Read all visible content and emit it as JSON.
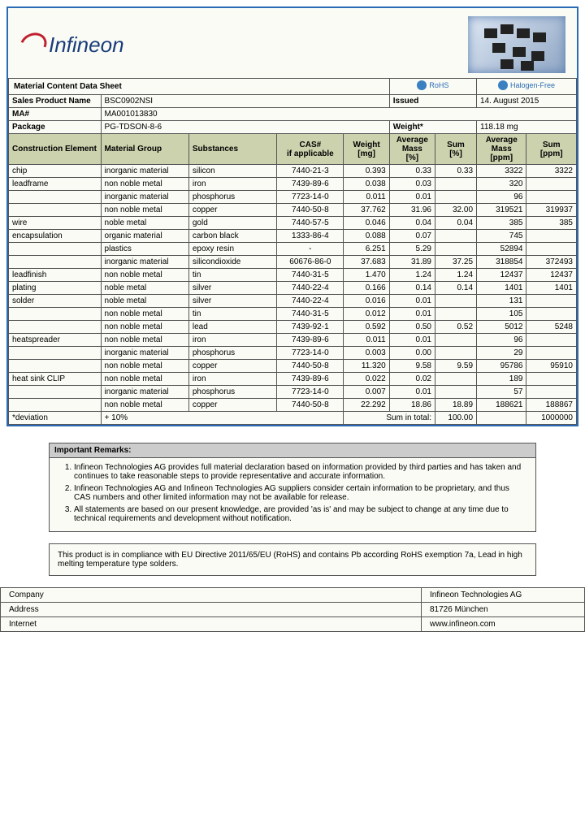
{
  "brand": "Infineon",
  "title": "Material Content Data Sheet",
  "badges": {
    "rohs": "RoHS",
    "halogenfree": "Halogen-Free"
  },
  "fields": {
    "sales_label": "Sales Product Name",
    "sales_value": "BSC0902NSI",
    "issued_label": "Issued",
    "issued_value": "14. August 2015",
    "ma_label": "MA#",
    "ma_value": "MA001013830",
    "package_label": "Package",
    "package_value": "PG-TDSON-8-6",
    "weight_label": "Weight*",
    "weight_value": "118.18 mg"
  },
  "cols": {
    "construction": "Construction Element",
    "group": "Material Group",
    "substance": "Substances",
    "cas": "CAS#\nif applicable",
    "wt_mg": "Weight\n[mg]",
    "avg_pct": "Average\nMass\n[%]",
    "sum_pct": "Sum\n[%]",
    "avg_ppm": "Average\nMass\n[ppm]",
    "sum_ppm": "Sum\n[ppm]"
  },
  "rows": [
    {
      "c": "chip",
      "g": "inorganic material",
      "s": "silicon",
      "cas": "7440-21-3",
      "w": "0.393",
      "ap": "0.33",
      "sp": "0.33",
      "appm": "3322",
      "sppm": "3322"
    },
    {
      "c": "leadframe",
      "g": "non noble metal",
      "s": "iron",
      "cas": "7439-89-6",
      "w": "0.038",
      "ap": "0.03",
      "sp": "",
      "appm": "320",
      "sppm": ""
    },
    {
      "c": "",
      "g": "inorganic material",
      "s": "phosphorus",
      "cas": "7723-14-0",
      "w": "0.011",
      "ap": "0.01",
      "sp": "",
      "appm": "96",
      "sppm": ""
    },
    {
      "c": "",
      "g": "non noble metal",
      "s": "copper",
      "cas": "7440-50-8",
      "w": "37.762",
      "ap": "31.96",
      "sp": "32.00",
      "appm": "319521",
      "sppm": "319937"
    },
    {
      "c": "wire",
      "g": "noble metal",
      "s": "gold",
      "cas": "7440-57-5",
      "w": "0.046",
      "ap": "0.04",
      "sp": "0.04",
      "appm": "385",
      "sppm": "385"
    },
    {
      "c": "encapsulation",
      "g": "organic material",
      "s": "carbon black",
      "cas": "1333-86-4",
      "w": "0.088",
      "ap": "0.07",
      "sp": "",
      "appm": "745",
      "sppm": ""
    },
    {
      "c": "",
      "g": "plastics",
      "s": "epoxy resin",
      "cas": "-",
      "w": "6.251",
      "ap": "5.29",
      "sp": "",
      "appm": "52894",
      "sppm": ""
    },
    {
      "c": "",
      "g": "inorganic material",
      "s": "silicondioxide",
      "cas": "60676-86-0",
      "w": "37.683",
      "ap": "31.89",
      "sp": "37.25",
      "appm": "318854",
      "sppm": "372493"
    },
    {
      "c": "leadfinish",
      "g": "non noble metal",
      "s": "tin",
      "cas": "7440-31-5",
      "w": "1.470",
      "ap": "1.24",
      "sp": "1.24",
      "appm": "12437",
      "sppm": "12437"
    },
    {
      "c": "plating",
      "g": "noble metal",
      "s": "silver",
      "cas": "7440-22-4",
      "w": "0.166",
      "ap": "0.14",
      "sp": "0.14",
      "appm": "1401",
      "sppm": "1401"
    },
    {
      "c": "solder",
      "g": "noble metal",
      "s": "silver",
      "cas": "7440-22-4",
      "w": "0.016",
      "ap": "0.01",
      "sp": "",
      "appm": "131",
      "sppm": ""
    },
    {
      "c": "",
      "g": "non noble metal",
      "s": "tin",
      "cas": "7440-31-5",
      "w": "0.012",
      "ap": "0.01",
      "sp": "",
      "appm": "105",
      "sppm": ""
    },
    {
      "c": "",
      "g": "non noble metal",
      "s": "lead",
      "cas": "7439-92-1",
      "w": "0.592",
      "ap": "0.50",
      "sp": "0.52",
      "appm": "5012",
      "sppm": "5248"
    },
    {
      "c": "heatspreader",
      "g": "non noble metal",
      "s": "iron",
      "cas": "7439-89-6",
      "w": "0.011",
      "ap": "0.01",
      "sp": "",
      "appm": "96",
      "sppm": ""
    },
    {
      "c": "",
      "g": "inorganic material",
      "s": "phosphorus",
      "cas": "7723-14-0",
      "w": "0.003",
      "ap": "0.00",
      "sp": "",
      "appm": "29",
      "sppm": ""
    },
    {
      "c": "",
      "g": "non noble metal",
      "s": "copper",
      "cas": "7440-50-8",
      "w": "11.320",
      "ap": "9.58",
      "sp": "9.59",
      "appm": "95786",
      "sppm": "95910"
    },
    {
      "c": "heat sink CLIP",
      "g": "non noble metal",
      "s": "iron",
      "cas": "7439-89-6",
      "w": "0.022",
      "ap": "0.02",
      "sp": "",
      "appm": "189",
      "sppm": ""
    },
    {
      "c": "",
      "g": "inorganic material",
      "s": "phosphorus",
      "cas": "7723-14-0",
      "w": "0.007",
      "ap": "0.01",
      "sp": "",
      "appm": "57",
      "sppm": ""
    },
    {
      "c": "",
      "g": "non noble metal",
      "s": "copper",
      "cas": "7440-50-8",
      "w": "22.292",
      "ap": "18.86",
      "sp": "18.89",
      "appm": "188621",
      "sppm": "188867"
    }
  ],
  "deviation_label": "*deviation",
  "deviation_value": "+ 10%",
  "total_label": "Sum in total:",
  "total_pct": "100.00",
  "total_ppm": "1000000",
  "remarks": {
    "title": "Important Remarks:",
    "items": [
      "Infineon Technologies AG provides full material declaration based on information provided by third parties and has taken and continues to take reasonable steps to provide representative and accurate information.",
      "Infineon Technologies AG and Infineon Technologies AG suppliers consider certain information to be proprietary, and thus CAS numbers and other limited information may not be available for release.",
      "All statements are based on our present knowledge, are provided 'as is' and may be subject to change at any time due to technical requirements and development without notification."
    ]
  },
  "compliance": "This product is in compliance with EU Directive 2011/65/EU (RoHS) and contains Pb according RoHS exemption 7a, Lead in high melting temperature type solders.",
  "company": {
    "company_label": "Company",
    "company_value": "Infineon Technologies AG",
    "address_label": "Address",
    "address_value": "81726 München",
    "internet_label": "Internet",
    "internet_value": "www.infineon.com"
  }
}
